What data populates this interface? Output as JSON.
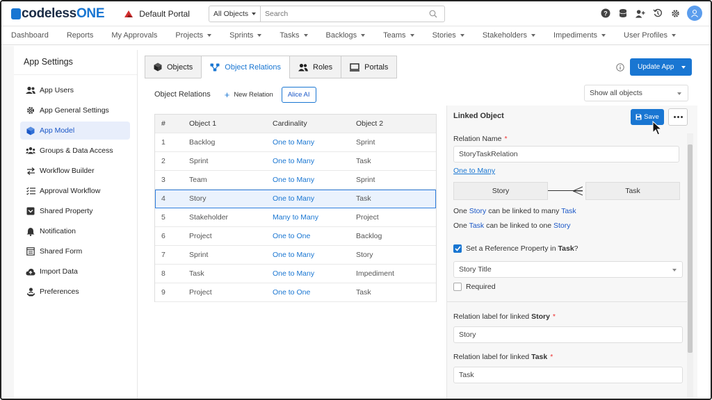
{
  "app": {
    "logo_prefix": "codeless",
    "logo_suffix": "ONE",
    "portal_name": "Default Portal"
  },
  "search": {
    "scope": "All Objects",
    "placeholder": "Search"
  },
  "nav": {
    "items": [
      "Dashboard",
      "Reports",
      "My Approvals",
      "Projects",
      "Sprints",
      "Tasks",
      "Backlogs",
      "Teams",
      "Stories",
      "Stakeholders",
      "Impediments",
      "User Profiles"
    ]
  },
  "sidebar": {
    "title": "App Settings",
    "items": [
      {
        "label": "App Users",
        "icon": "users-icon"
      },
      {
        "label": "App General Settings",
        "icon": "gear-icon"
      },
      {
        "label": "App Model",
        "icon": "cube-icon"
      },
      {
        "label": "Groups & Data Access",
        "icon": "group-icon"
      },
      {
        "label": "Workflow Builder",
        "icon": "workflow-icon"
      },
      {
        "label": "Approval Workflow",
        "icon": "checklist-icon"
      },
      {
        "label": "Shared Property",
        "icon": "property-icon"
      },
      {
        "label": "Notification",
        "icon": "bell-icon"
      },
      {
        "label": "Shared Form",
        "icon": "form-icon"
      },
      {
        "label": "Import Data",
        "icon": "upload-icon"
      },
      {
        "label": "Preferences",
        "icon": "preferences-icon"
      }
    ],
    "active_index": 2
  },
  "tabs": [
    {
      "label": "Objects",
      "icon": "cube-icon"
    },
    {
      "label": "Object Relations",
      "icon": "relations-icon"
    },
    {
      "label": "Roles",
      "icon": "roles-icon"
    },
    {
      "label": "Portals",
      "icon": "monitor-icon"
    }
  ],
  "toolbar": {
    "update_label": "Update App",
    "title": "Object Relations",
    "new_relation": "New Relation",
    "alice": "Alice AI",
    "filter": "Show all objects"
  },
  "table": {
    "headers": [
      "#",
      "Object 1",
      "Cardinality",
      "Object 2"
    ],
    "rows": [
      [
        "1",
        "Backlog",
        "One to Many",
        "Sprint"
      ],
      [
        "2",
        "Sprint",
        "One to Many",
        "Task"
      ],
      [
        "3",
        "Team",
        "One to Many",
        "Sprint"
      ],
      [
        "4",
        "Story",
        "One to Many",
        "Task"
      ],
      [
        "5",
        "Stakeholder",
        "Many to Many",
        "Project"
      ],
      [
        "6",
        "Project",
        "One to One",
        "Backlog"
      ],
      [
        "7",
        "Sprint",
        "One to Many",
        "Story"
      ],
      [
        "8",
        "Task",
        "One to Many",
        "Impediment"
      ],
      [
        "9",
        "Project",
        "One to One",
        "Task"
      ]
    ],
    "selected_row": 3
  },
  "panel": {
    "title": "Linked Object",
    "save_label": "Save",
    "relation_name_label": "Relation Name",
    "relation_name_value": "StoryTaskRelation",
    "cardinality_link": "One to Many",
    "left_object": "Story",
    "right_object": "Task",
    "desc1": {
      "pre": "One ",
      "a": "Story",
      "mid": " can be linked to many ",
      "b": "Task"
    },
    "desc2": {
      "pre": "One ",
      "a": "Task",
      "mid": " can be linked to one ",
      "b": "Story"
    },
    "ref_prop": {
      "pre": "Set a Reference Property in ",
      "obj": "Task",
      "post": "?"
    },
    "ref_select": "Story Title",
    "required_label": "Required",
    "label_story": {
      "pre": "Relation label for linked ",
      "obj": "Story"
    },
    "label_story_value": "Story",
    "label_task": {
      "pre": "Relation label for linked ",
      "obj": "Task"
    },
    "label_task_value": "Task"
  },
  "colors": {
    "accent": "#1976d2",
    "selected_bg": "#eaf2fd",
    "active_sidebar_bg": "#e8eefb"
  }
}
